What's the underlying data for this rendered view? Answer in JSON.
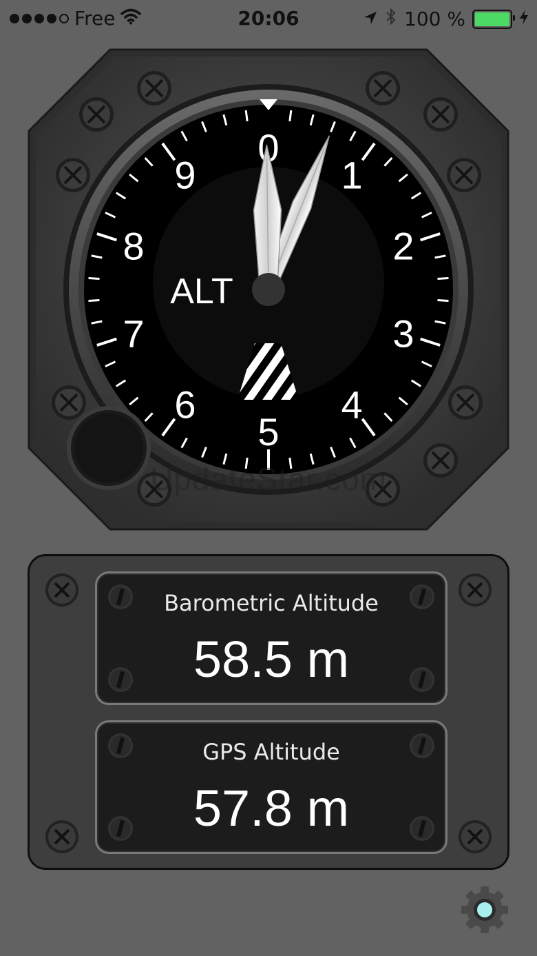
{
  "status_bar": {
    "carrier": "Free",
    "time": "20:06",
    "battery_percent": "100 %",
    "battery_level": 1.0,
    "battery_color": "#4cd964"
  },
  "altimeter": {
    "label": "ALT",
    "dial_numbers": [
      "0",
      "1",
      "2",
      "3",
      "4",
      "5",
      "6",
      "7",
      "8",
      "9"
    ],
    "long_hand_value": 0.6,
    "short_hand_value": 9.98
  },
  "readouts": {
    "barometric": {
      "label": "Barometric Altitude",
      "value": "58.5 m"
    },
    "gps": {
      "label": "GPS Altitude",
      "value": "57.8 m"
    }
  },
  "watermark": "UpdateStar.com",
  "icons": {
    "settings": "gear-icon",
    "wifi": "wifi-icon",
    "location": "location-arrow-icon",
    "bluetooth": "bluetooth-icon",
    "charging": "charging-bolt-icon"
  },
  "colors": {
    "background": "#626262",
    "dial_face": "#000000",
    "accent": "#a8f0f0"
  }
}
